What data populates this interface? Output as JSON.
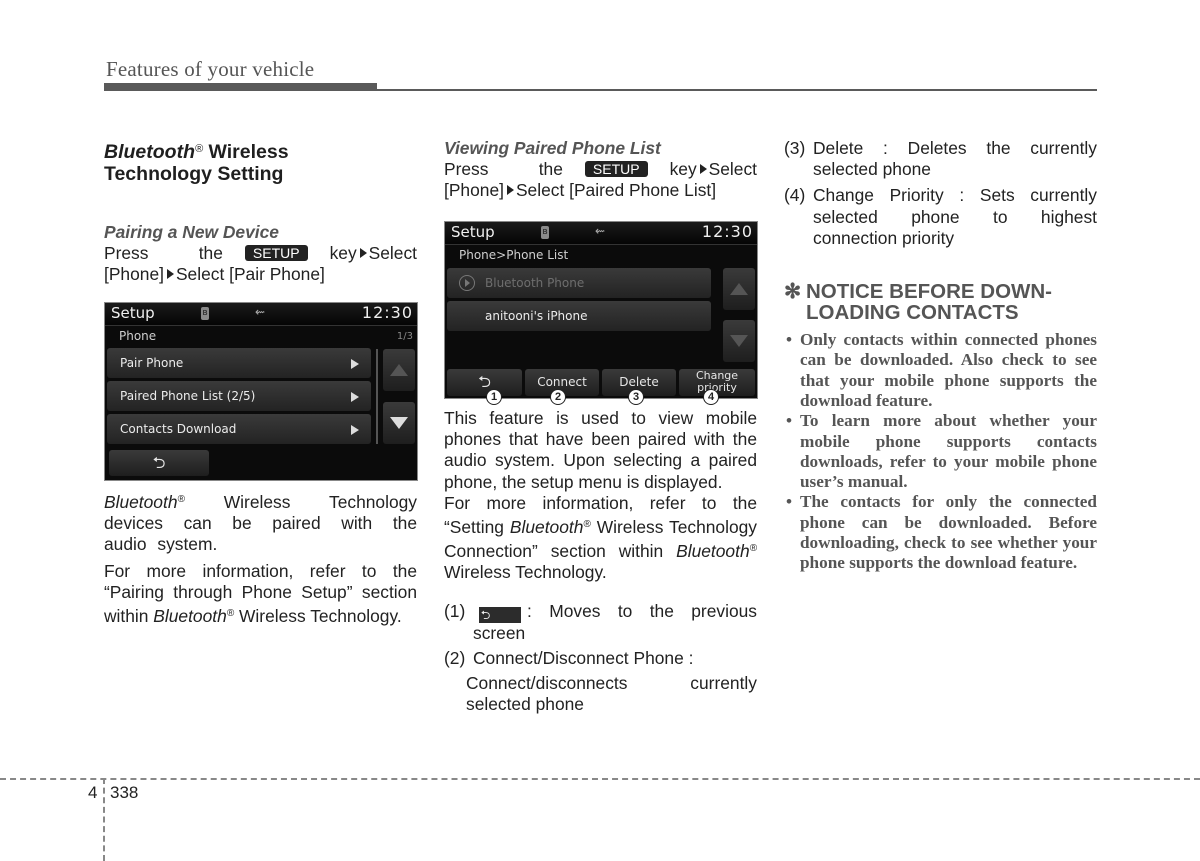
{
  "header": {
    "running_title": "Features of your vehicle"
  },
  "column1": {
    "section_title_italic": "Bluetooth",
    "registered": "®",
    "section_title_rest": " Wireless Technology Setting",
    "subsection_title": "Pairing a New Device",
    "instruction": {
      "prefix": "Press the",
      "key_label": "SETUP",
      "after_key": "key",
      "step1": "Select [Phone]",
      "step2": "Select [Pair Phone]"
    },
    "screen": {
      "title": "Setup",
      "bluetooth_icon": "bluetooth-icon",
      "usb_icon": "usb-icon",
      "time": "12:30",
      "subheader": "Phone",
      "page_indicator": "1/3",
      "items": [
        {
          "label": "Pair Phone"
        },
        {
          "label": "Paired Phone List (2/5)"
        },
        {
          "label": "Contacts Download"
        }
      ],
      "back_icon": "back-arrow-icon"
    },
    "para1_italic": "Bluetooth",
    "para1_rest": " Wireless Technology devices can be paired with the audio system.",
    "para2_a": "For more information, refer to the “Pairing through Phone Setup” section within ",
    "para2_italic": "Bluetooth",
    "para2_b": " Wireless Technology."
  },
  "column2": {
    "subsection_title": "Viewing Paired Phone List",
    "instruction": {
      "prefix": "Press the",
      "key_label": "SETUP",
      "after_key": "key",
      "step1": "Select [Phone]",
      "step2": "Select [Paired Phone List]"
    },
    "screen": {
      "title": "Setup",
      "time": "12:30",
      "breadcrumb": "Phone>Phone List",
      "items": [
        {
          "label": "Bluetooth Phone",
          "dimmed": true
        },
        {
          "label": "anitooni's iPhone",
          "dimmed": false
        }
      ],
      "buttons": [
        {
          "label": "",
          "icon": "back-arrow-icon",
          "callout": "1"
        },
        {
          "label": "Connect",
          "callout": "2"
        },
        {
          "label": "Delete",
          "callout": "3"
        },
        {
          "label": "Change priority",
          "callout": "4"
        }
      ]
    },
    "para1": "This feature is used to view mobile phones that have been paired with the audio system. Upon selecting a paired phone, the setup menu is displayed.",
    "para2_a": "For more information, refer to the “Setting ",
    "para2_italic1": "Bluetooth",
    "para2_b": " Wireless Technology Connection” section within ",
    "para2_italic2": "Bluetooth",
    "para2_c": " Wireless Technology.",
    "list": [
      {
        "num": "(1)",
        "text": ": Moves to the previous screen"
      },
      {
        "num": "(2)",
        "text": "Connect/Disconnect Phone :",
        "detail": "Connect/disconnects currently selected phone"
      }
    ]
  },
  "column3": {
    "list": [
      {
        "num": "(3)",
        "text": "Delete : Deletes the currently selected phone"
      },
      {
        "num": "(4)",
        "text": "Change Priority : Sets currently selected phone to highest connection priority"
      }
    ],
    "notice": {
      "symbol": "✻",
      "title_line1": "NOTICE BEFORE DOWN-",
      "title_line2": "LOADING CONTACTS",
      "bullets": [
        "Only contacts within connected phones can be downloaded. Also check to see that your mobile phone supports the download feature.",
        "To learn more about whether your mobile phone supports contacts downloads, refer to your mobile phone user’s manual.",
        "The contacts for only the connected phone can be downloaded. Before downloading, check to see whether your phone supports the download feature."
      ]
    }
  },
  "footer": {
    "chapter": "4",
    "page": "338"
  }
}
